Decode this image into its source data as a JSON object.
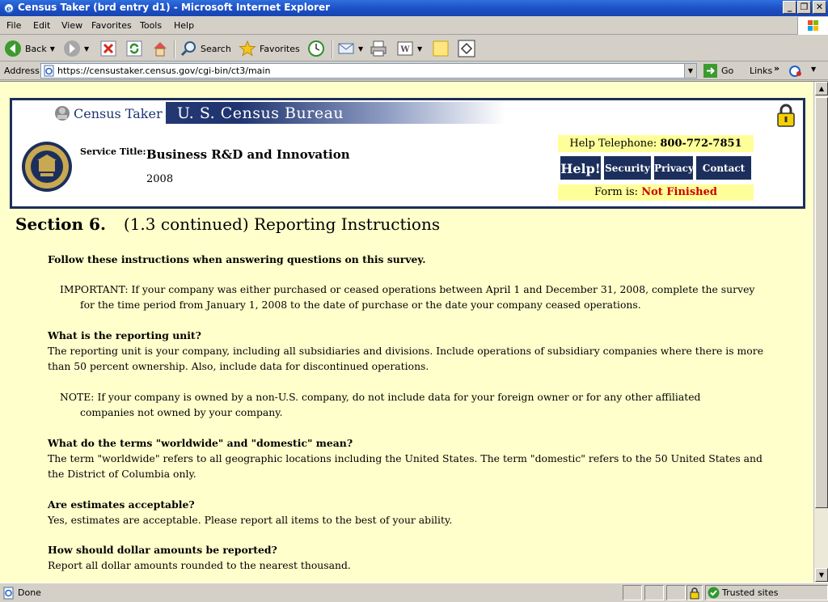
{
  "window": {
    "title": "Census Taker (brd entry d1) - Microsoft Internet Explorer",
    "minimize": "_",
    "restore": "❐",
    "close": "✕"
  },
  "menu": [
    "File",
    "Edit",
    "View",
    "Favorites",
    "Tools",
    "Help"
  ],
  "toolbar": {
    "back": "Back",
    "search": "Search",
    "favorites": "Favorites"
  },
  "address": {
    "label": "Address",
    "url": "https://censustaker.census.gov/cgi-bin/ct3/main",
    "go": "Go",
    "links": "Links"
  },
  "header": {
    "app_name": "Census Taker",
    "bureau": "U. S. Census Bureau",
    "service_label": "Service Title:",
    "service_title": "Business R&D and Innovation",
    "year": "2008",
    "help_tel_label": "Help Telephone:",
    "help_tel_number": "800-772-7851",
    "buttons": {
      "help": "Help!",
      "security": "Security",
      "privacy": "Privacy",
      "contact": "Contact Us"
    },
    "form_label": "Form is:",
    "form_status": "Not Finished",
    "status_color": "#cc0000"
  },
  "section": {
    "number": "Section 6.",
    "title": "(1.3 continued) Reporting Instructions"
  },
  "content": {
    "intro": "Follow these instructions when answering questions on this survey.",
    "important_label": "IMPORTANT:",
    "important_text": "If your company was either purchased or ceased operations between April 1 and December 31, 2008, complete the survey for the time period from January 1, 2008 to the date of purchase or the date your company ceased operations.",
    "q1": "What is the reporting unit?",
    "a1": "The reporting unit is your company, including all subsidiaries and divisions. Include operations of subsidiary companies where there is more than 50 percent ownership. Also, include data for discontinued operations.",
    "note_label": "NOTE:",
    "note_text": "If your company is owned by a non-U.S. company, do not include data for your foreign owner or for any other affiliated companies not owned by your company.",
    "q2": "What do the terms \"worldwide\" and \"domestic\" mean?",
    "a2": "The term \"worldwide\" refers to all geographic locations including the United States. The term \"domestic\" refers to the 50 United States and the District of Columbia only.",
    "q3": "Are estimates acceptable?",
    "a3": "Yes, estimates are acceptable. Please report all items to the best of your ability.",
    "q4": "How should dollar amounts be reported?",
    "a4": "Report all dollar amounts rounded to the nearest thousand."
  },
  "status": {
    "text": "Done",
    "zone": "Trusted sites"
  }
}
